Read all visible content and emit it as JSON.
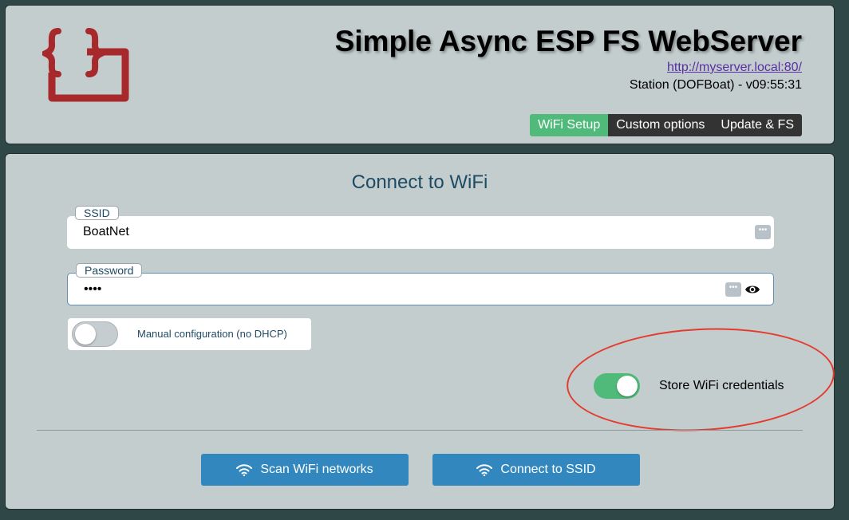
{
  "header": {
    "title": "Simple Async ESP FS WebServer",
    "server_url": "http://myserver.local:80/",
    "station_info": "Station (DOFBoat) - v09:55:31",
    "logo_icon": "curly-braces-logo",
    "logo_color": "#a8292b"
  },
  "tabs": [
    {
      "label": "WiFi Setup",
      "active": true
    },
    {
      "label": "Custom options",
      "active": false
    },
    {
      "label": "Update & FS",
      "active": false
    }
  ],
  "main": {
    "title": "Connect to WiFi",
    "ssid": {
      "label": "SSID",
      "value": "BoatNet"
    },
    "password": {
      "label": "Password",
      "value": "••••"
    },
    "manual_config": {
      "label": "Manual configuration (no DHCP)",
      "enabled": false
    },
    "store_credentials": {
      "label": "Store WiFi credentials",
      "enabled": true
    },
    "buttons": {
      "scan": {
        "label": "Scan WiFi networks",
        "icon": "wifi-icon"
      },
      "connect": {
        "label": "Connect to SSID",
        "icon": "wifi-icon"
      }
    }
  },
  "colors": {
    "background": "#2f4747",
    "panel": "#c3cdcd",
    "accent_green": "#4fba79",
    "button_blue": "#3288be",
    "annotation_red": "#e53b2f"
  }
}
